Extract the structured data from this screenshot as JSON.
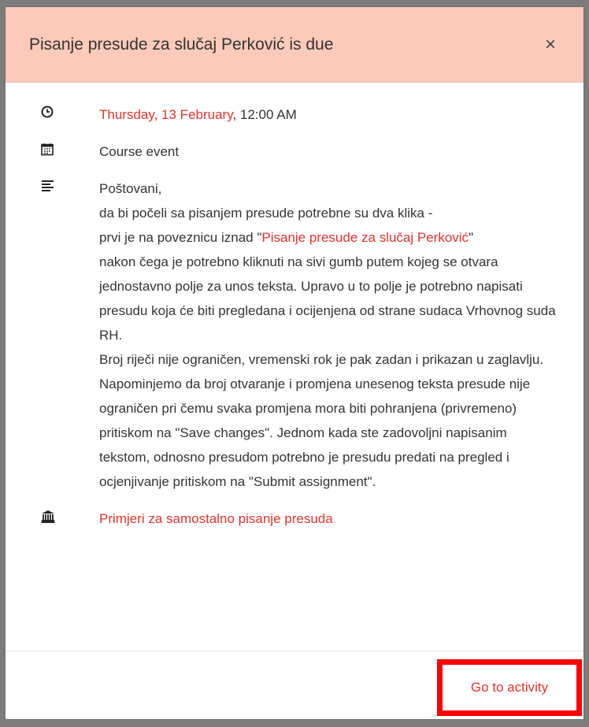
{
  "modal": {
    "title": "Pisanje presude za slučaj Perković is due",
    "close_label": "×"
  },
  "event": {
    "date_link": "Thursday, 13 February",
    "time": ", 12:00 AM",
    "type": "Course event",
    "description": {
      "line1": "Poštovani,",
      "line2": "da bi počeli sa pisanjem presude potrebne su dva klika -",
      "line3": "prvi je na poveznicu iznad \"",
      "link": "Pisanje presude za slučaj Perković",
      "line3_end": "\"",
      "line4": "nakon čega je potrebno kliknuti na sivi gumb putem kojeg se otvara jednostavno polje za unos teksta. Upravo u to polje je potrebno napisati presudu koja će biti pregledana i ocijenjena od strane sudaca Vrhovnog suda RH.",
      "line5": "Broj riječi nije ograničen, vremenski rok je pak zadan i prikazan u zaglavlju.",
      "line6": "Napominjemo da broj otvaranje i promjena unesenog teksta presude nije ograničen pri čemu svaka promjena mora biti pohranjena (privremeno) pritiskom na \"Save changes\". Jednom kada ste zadovoljni napisanim tekstom, odnosno presudom potrebno je presudu predati na pregled i ocjenjivanje pritiskom na \"Submit assignment\"."
    },
    "course_link": "Primjeri za samostalno pisanje presuda"
  },
  "footer": {
    "go_to_activity": "Go to activity"
  },
  "icons": [
    "clock-icon",
    "calendar-icon",
    "description-icon",
    "course-icon",
    "close-icon"
  ],
  "colors": {
    "header_bg": "#fbcab8",
    "link": "#e8322b",
    "highlight_border": "#ff0000"
  }
}
